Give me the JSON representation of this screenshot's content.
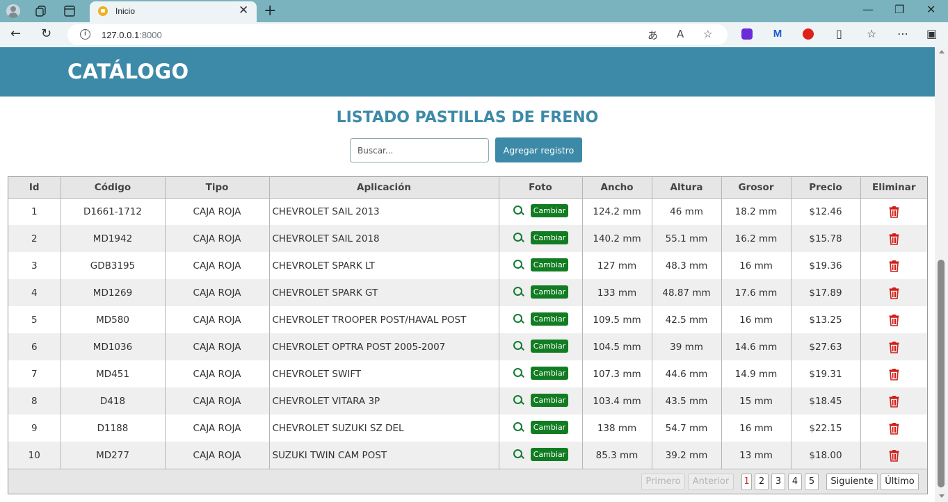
{
  "browser": {
    "tab_title": "Inicio",
    "tab_close": "✕",
    "new_tab": "+",
    "url_host": "127.0.0.1",
    "url_port": ":8000",
    "window": {
      "minimize": "—",
      "restore": "❐",
      "close": "✕"
    }
  },
  "header": {
    "brand": "CATÁLOGO"
  },
  "page": {
    "title": "LISTADO PASTILLAS DE FRENO",
    "search_placeholder": "Buscar...",
    "add_button": "Agregar registro"
  },
  "table": {
    "columns": [
      "Id",
      "Código",
      "Tipo",
      "Aplicación",
      "Foto",
      "Ancho",
      "Altura",
      "Grosor",
      "Precio",
      "Eliminar"
    ],
    "change_label": "Cambiar",
    "rows": [
      {
        "id": "1",
        "codigo": "D1661-1712",
        "tipo": "CAJA ROJA",
        "aplicacion": "CHEVROLET SAIL 2013",
        "ancho": "124.2 mm",
        "altura": "46 mm",
        "grosor": "18.2 mm",
        "precio": "$12.46"
      },
      {
        "id": "2",
        "codigo": "MD1942",
        "tipo": "CAJA ROJA",
        "aplicacion": "CHEVROLET SAIL 2018",
        "ancho": "140.2 mm",
        "altura": "55.1 mm",
        "grosor": "16.2 mm",
        "precio": "$15.78"
      },
      {
        "id": "3",
        "codigo": "GDB3195",
        "tipo": "CAJA ROJA",
        "aplicacion": "CHEVROLET SPARK LT",
        "ancho": "127 mm",
        "altura": "48.3 mm",
        "grosor": "16 mm",
        "precio": "$19.36"
      },
      {
        "id": "4",
        "codigo": "MD1269",
        "tipo": "CAJA ROJA",
        "aplicacion": "CHEVROLET SPARK GT",
        "ancho": "133 mm",
        "altura": "48.87 mm",
        "grosor": "17.6 mm",
        "precio": "$17.89"
      },
      {
        "id": "5",
        "codigo": "MD580",
        "tipo": "CAJA ROJA",
        "aplicacion": "CHEVROLET TROOPER POST/HAVAL POST",
        "ancho": "109.5 mm",
        "altura": "42.5 mm",
        "grosor": "16 mm",
        "precio": "$13.25"
      },
      {
        "id": "6",
        "codigo": "MD1036",
        "tipo": "CAJA ROJA",
        "aplicacion": "CHEVROLET OPTRA POST 2005-2007",
        "ancho": "104.5 mm",
        "altura": "39 mm",
        "grosor": "14.6 mm",
        "precio": "$27.63"
      },
      {
        "id": "7",
        "codigo": "MD451",
        "tipo": "CAJA ROJA",
        "aplicacion": "CHEVROLET SWIFT",
        "ancho": "107.3 mm",
        "altura": "44.6 mm",
        "grosor": "14.9 mm",
        "precio": "$19.31"
      },
      {
        "id": "8",
        "codigo": "D418",
        "tipo": "CAJA ROJA",
        "aplicacion": "CHEVROLET VITARA 3P",
        "ancho": "103.4 mm",
        "altura": "43.5 mm",
        "grosor": "15 mm",
        "precio": "$18.45"
      },
      {
        "id": "9",
        "codigo": "D1188",
        "tipo": "CAJA ROJA",
        "aplicacion": "CHEVROLET SUZUKI SZ DEL",
        "ancho": "138 mm",
        "altura": "54.7 mm",
        "grosor": "16 mm",
        "precio": "$22.15"
      },
      {
        "id": "10",
        "codigo": "MD277",
        "tipo": "CAJA ROJA",
        "aplicacion": "SUZUKI TWIN CAM POST",
        "ancho": "85.3 mm",
        "altura": "39.2 mm",
        "grosor": "13 mm",
        "precio": "$18.00"
      }
    ]
  },
  "pagination": {
    "first": "Primero",
    "prev": "Anterior",
    "pages": [
      "1",
      "2",
      "3",
      "4",
      "5"
    ],
    "current_page": 1,
    "next": "Siguiente",
    "last": "Último"
  },
  "colors": {
    "brand": "#3d8aa8",
    "change_button": "#127c22",
    "delete_icon": "#d0201a",
    "zoom_icon": "#137a32"
  }
}
